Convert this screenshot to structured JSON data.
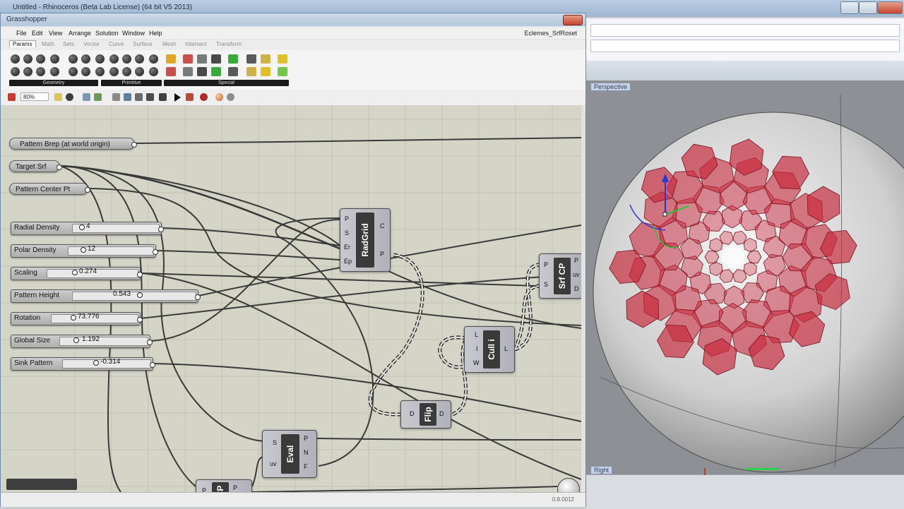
{
  "rhino": {
    "title": "Untitled - Rhinoceros (Beta Lab License) (64 bit V5 2013)",
    "viewport_label": "Perspective",
    "viewport_label_bottom": "Right"
  },
  "gh": {
    "title": "Grasshopper",
    "doc_name": "Eclemes_SrfRoset",
    "menu": [
      "File",
      "Edit",
      "View",
      "Arrange",
      "Solution",
      "Window",
      "Help"
    ],
    "tabs": [
      "Params",
      "Math",
      "Sets",
      "Vector",
      "Curve",
      "Surface",
      "Mesh",
      "Intersect",
      "Transform"
    ],
    "ribbon_groups": [
      "Geometry",
      "Primitive",
      "Special"
    ],
    "zoom": "80%",
    "version": "0.8.0012",
    "params": {
      "pattern_brep": "Pattern Brep (at world origin)",
      "target_srf": "Target Srf",
      "pattern_center_pt": "Pattern Center Pt"
    },
    "sliders": [
      {
        "label": "Radial Density",
        "value": "4"
      },
      {
        "label": "Polar Density",
        "value": "12"
      },
      {
        "label": "Scaling",
        "value": "0.274"
      },
      {
        "label": "Pattern Height",
        "value": "0.543"
      },
      {
        "label": "Rotation",
        "value": "73.776"
      },
      {
        "label": "Global Size",
        "value": "1.192"
      },
      {
        "label": "Sink Pattern",
        "value": "-0.314"
      }
    ],
    "components": {
      "radgrid": {
        "name": "RadGrid",
        "inputs": [
          "P",
          "S",
          "Er",
          "Ep"
        ],
        "outputs": [
          "C",
          "P"
        ]
      },
      "srfcp": {
        "name": "Srf CP",
        "inputs": [
          "P",
          "S"
        ],
        "outputs": [
          "P",
          "uv",
          "D"
        ]
      },
      "culli": {
        "name": "Cull i",
        "inputs": [
          "L",
          "I",
          "W"
        ],
        "outputs": [
          "L"
        ]
      },
      "flip": {
        "name": "Flip",
        "inputs": [
          "D"
        ],
        "outputs": [
          "D"
        ]
      },
      "eval": {
        "name": "Eval",
        "inputs": [
          "S",
          "uv"
        ],
        "outputs": [
          "P",
          "N",
          "F"
        ]
      },
      "cp": {
        "name": "CP",
        "inputs": [
          "P"
        ],
        "outputs": [
          "P",
          "D"
        ]
      }
    }
  },
  "colors": {
    "canvas": "#d4d4c7",
    "pattern": "#c8283c",
    "wire": "#3a3a3a"
  }
}
